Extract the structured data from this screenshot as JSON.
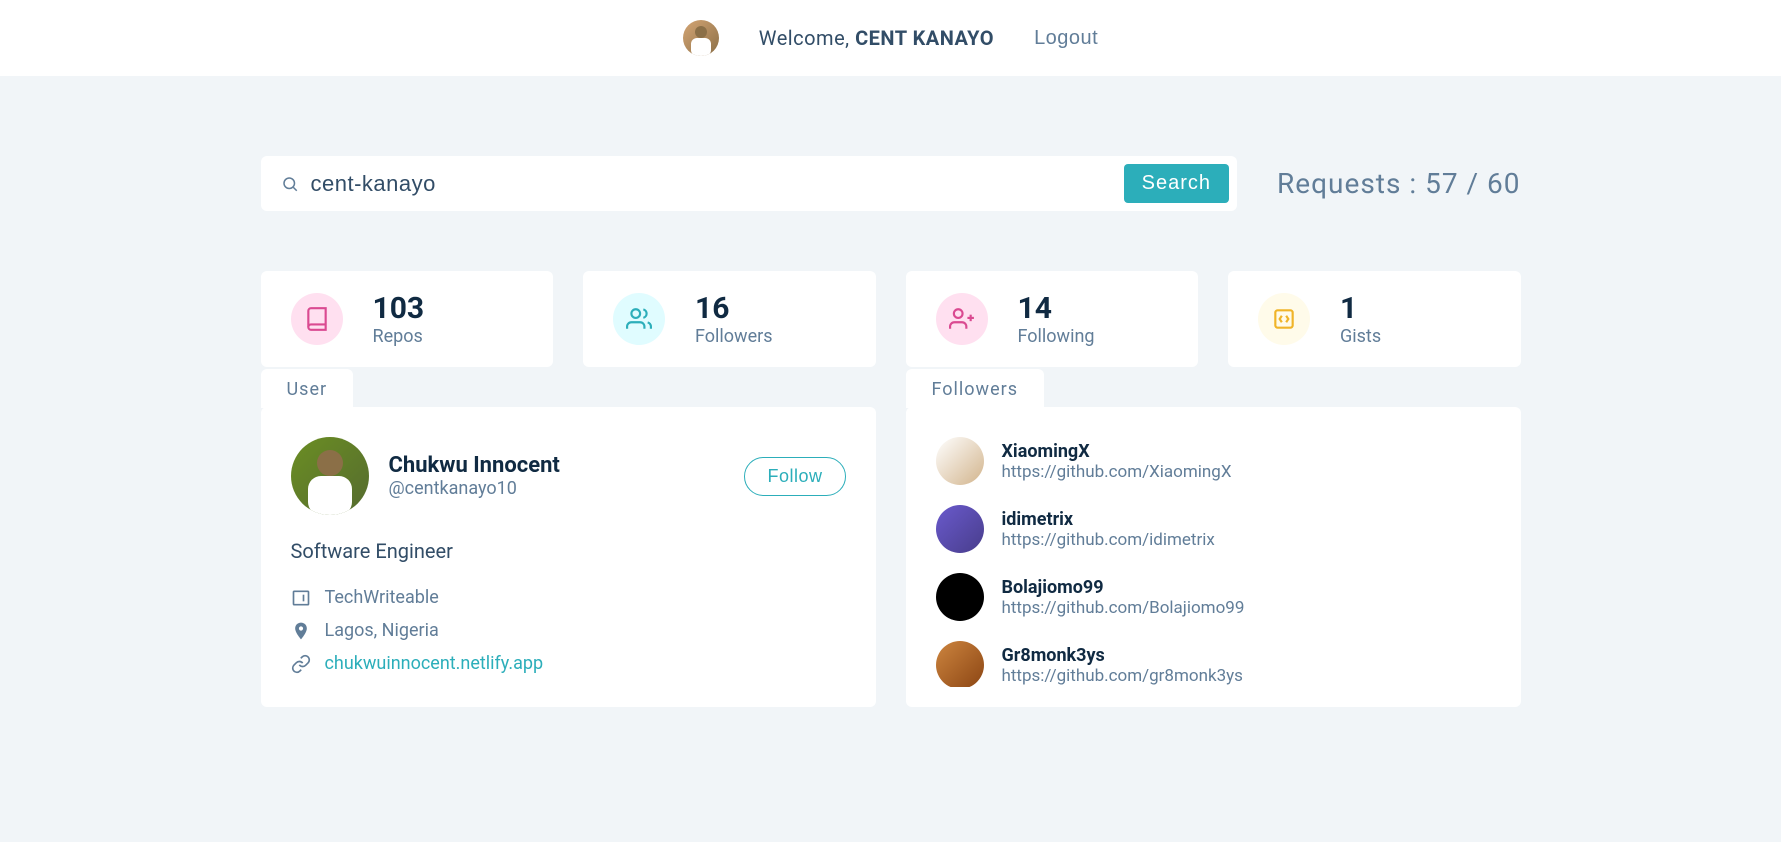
{
  "navbar": {
    "welcome_prefix": "Welcome, ",
    "username": "CENT KANAYO",
    "logout": "Logout"
  },
  "search": {
    "value": "cent-kanayo",
    "button": "Search"
  },
  "requests": {
    "label": "Requests : ",
    "current": 57,
    "max": 60
  },
  "stats": [
    {
      "value": "103",
      "label": "Repos",
      "icon": "repos"
    },
    {
      "value": "16",
      "label": "Followers",
      "icon": "followers"
    },
    {
      "value": "14",
      "label": "Following",
      "icon": "following"
    },
    {
      "value": "1",
      "label": "Gists",
      "icon": "gists"
    }
  ],
  "user": {
    "tab": "User",
    "name": "Chukwu Innocent",
    "handle": "@centkanayo10",
    "follow_btn": "Follow",
    "bio": "Software Engineer",
    "company": "TechWriteable",
    "location": "Lagos, Nigeria",
    "blog": "chukwuinnocent.netlify.app"
  },
  "followers": {
    "tab": "Followers",
    "list": [
      {
        "name": "XiaomingX",
        "url": "https://github.com/XiaomingX"
      },
      {
        "name": "idimetrix",
        "url": "https://github.com/idimetrix"
      },
      {
        "name": "Bolajiomo99",
        "url": "https://github.com/Bolajiomo99"
      },
      {
        "name": "Gr8monk3ys",
        "url": "https://github.com/gr8monk3ys"
      }
    ]
  }
}
